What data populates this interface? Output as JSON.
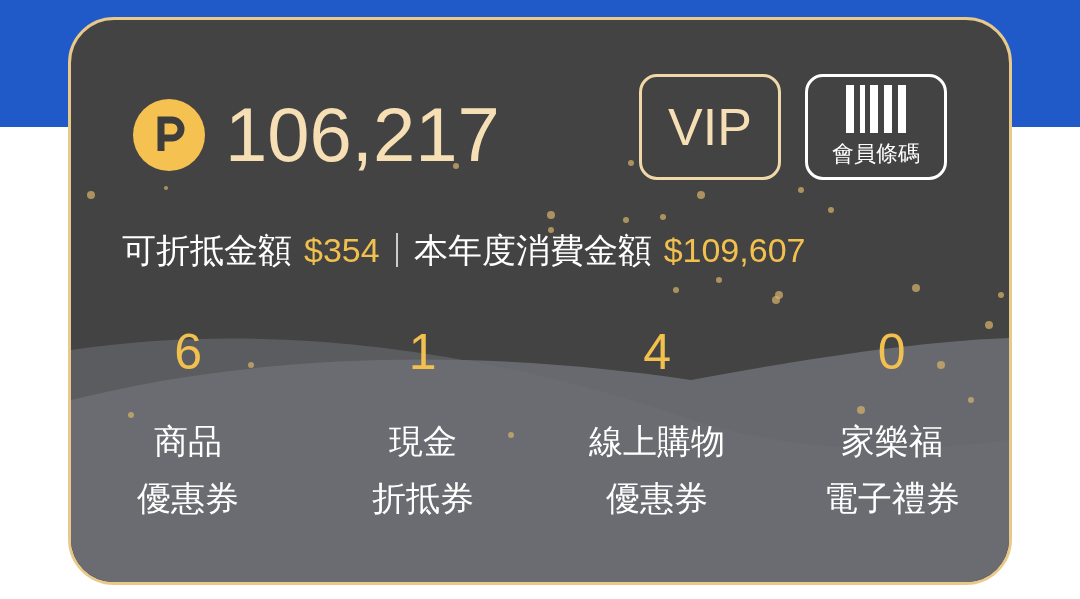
{
  "points": {
    "value": "106,217"
  },
  "buttons": [
    {
      "kind": "text",
      "label": "VIP"
    },
    {
      "kind": "barcode",
      "label": "會員條碼"
    }
  ],
  "summary": [
    {
      "label": "可折抵金額",
      "value": "$354"
    },
    {
      "label": "本年度消費金額",
      "value": "$109,607"
    }
  ],
  "coupons": [
    {
      "count": "6",
      "label_lines": [
        "商品",
        "優惠券"
      ]
    },
    {
      "count": "1",
      "label_lines": [
        "現金",
        "折抵券"
      ]
    },
    {
      "count": "4",
      "label_lines": [
        "線上購物",
        "優惠券"
      ]
    },
    {
      "count": "0",
      "label_lines": [
        "家樂福",
        "電子禮券"
      ]
    }
  ]
}
